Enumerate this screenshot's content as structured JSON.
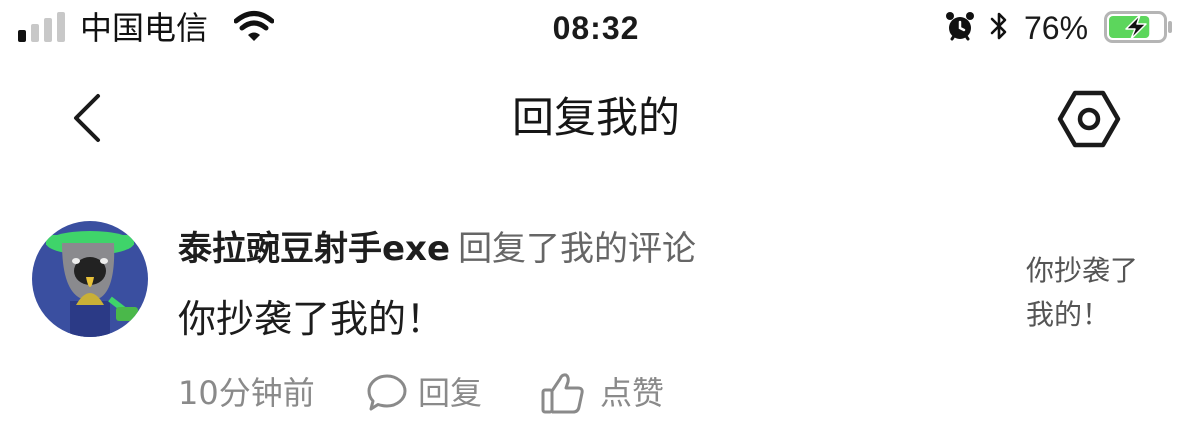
{
  "status_bar": {
    "carrier": "中国电信",
    "time": "08:32",
    "battery_percent": "76%",
    "battery_level": 0.76,
    "signal_bars_active": 1,
    "signal_bars_total": 4,
    "icons": [
      "signal-icon",
      "wifi-icon",
      "alarm-icon",
      "bluetooth-icon",
      "battery-charging-icon"
    ]
  },
  "nav": {
    "title": "回复我的",
    "back_icon": "chevron-left-icon",
    "settings_icon": "hexagon-settings-icon"
  },
  "reply": {
    "username": "泰拉豌豆射手exe",
    "action": "回复了我的评论",
    "content": "你抄袭了我的！",
    "original_comment": "你抄袭了我的！",
    "time": "10分钟前",
    "reply_label": "回复",
    "like_label": "点赞"
  },
  "colors": {
    "text_primary": "#1a1a1a",
    "text_secondary": "#666666",
    "text_meta": "#8a8a8a",
    "battery_green": "#5cd65c",
    "avatar_bg": "#3a4fa0",
    "avatar_hat": "#3fd46a"
  }
}
